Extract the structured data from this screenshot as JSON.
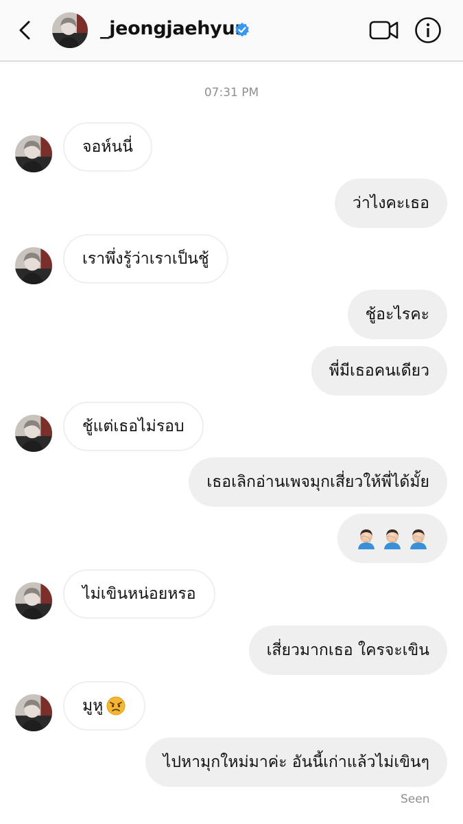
{
  "header": {
    "username": "_jeongjaehyun",
    "verified": true
  },
  "timestamp": "07:31 PM",
  "messages": [
    {
      "from": "them",
      "text": "จอห์นนี่"
    },
    {
      "from": "me",
      "text": "ว่าไงคะเธอ"
    },
    {
      "from": "them",
      "text": "เราพึ่งรู้ว่าเราเป็นชู้"
    },
    {
      "from": "me",
      "text": "ชู้อะไรคะ"
    },
    {
      "from": "me",
      "text": "พี่มีเธอคนเดียว"
    },
    {
      "from": "them",
      "text": "ชู้แต่เธอไม่รอบ"
    },
    {
      "from": "me",
      "text": "เธอเลิกอ่านเพจมุกเสี่ยวให้พี่ได้มั้ย"
    },
    {
      "from": "me",
      "text": "",
      "emoji": "man-facepalming x3"
    },
    {
      "from": "them",
      "text": "ไม่เขินหน่อยหรอ"
    },
    {
      "from": "me",
      "text": "เสี่ยวมากเธอ ใครจะเขิน"
    },
    {
      "from": "them",
      "text": "มูหู",
      "emoji": "angry-face"
    },
    {
      "from": "me",
      "text": "ไปหามุกใหม่มาค่ะ อันนี้เก่าแล้วไม่เขินๆ"
    }
  ],
  "status": "Seen",
  "colors": {
    "header_bg": "#f9f9f9",
    "outgoing_bubble": "#efefef",
    "incoming_border": "#efefef",
    "verified_blue": "#3897f0",
    "muted_text": "#8e8e8e"
  }
}
